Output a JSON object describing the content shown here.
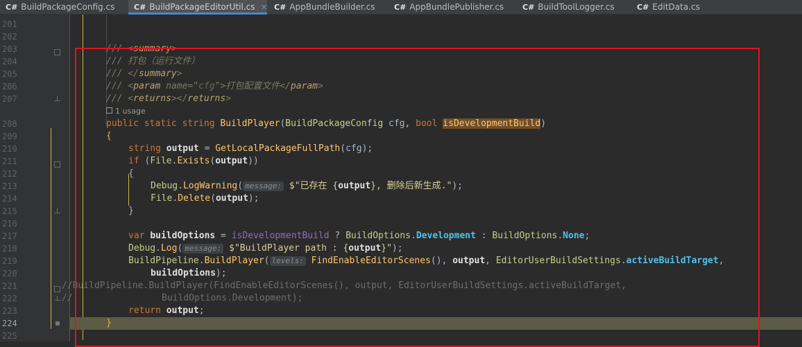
{
  "tabs": [
    {
      "icon": "C#",
      "label": "BuildPackageConfig.cs",
      "active": false
    },
    {
      "icon": "C#",
      "label": "BuildPackageEditorUtil.cs",
      "active": true,
      "close": "×"
    },
    {
      "icon": "C#",
      "label": "AppBundleBuilder.cs",
      "active": false
    },
    {
      "icon": "C#",
      "label": "AppBundlePublisher.cs",
      "active": false
    },
    {
      "icon": "C#",
      "label": "BuildToolLogger.cs",
      "active": false
    },
    {
      "icon": "C#",
      "label": "EditData.cs",
      "active": false
    }
  ],
  "editor": {
    "line_numbers": [
      "201",
      "202",
      "203",
      "204",
      "205",
      "206",
      "207",
      "208",
      "209",
      "210",
      "211",
      "212",
      "213",
      "214",
      "215",
      "216",
      "217",
      "218",
      "219",
      "220",
      "221",
      "222",
      "223",
      "224",
      "225"
    ],
    "current_line": "224",
    "usage_hint": "1 usage",
    "code": {
      "l203": {
        "a": "/// <",
        "b": "summary",
        "c": ">"
      },
      "l204": {
        "a": "/// 打包（运行文件）"
      },
      "l205": {
        "a": "/// </",
        "b": "summary",
        "c": ">"
      },
      "l206": {
        "a": "/// <",
        "b": "param",
        "c": " name=\"",
        "d": "cfg",
        "e": "\">打包配置文件</",
        "f": "param",
        "g": ">"
      },
      "l207": {
        "a": "/// <",
        "b": "returns",
        "c": "></",
        "d": "returns",
        "e": ">"
      },
      "l208": {
        "kw1": "public static string ",
        "mt": "BuildPlayer",
        "p1": "(",
        "ty": "BuildPackageConfig",
        "sp": " cfg, ",
        "kw2": "bool",
        "sp2": " ",
        "hl": "isDevelopmentBuild",
        "p2": ")"
      },
      "l209": {
        "brace": "{"
      },
      "l210": {
        "kw": "string",
        "sp": " ",
        "id": "output",
        "op": " = ",
        "mt": "GetLocalPackageFullPath",
        "rest": "(cfg);"
      },
      "l211": {
        "kw": "if",
        "a": " (",
        "ty": "File",
        "b": ".",
        "mt": "Exists",
        "c": "(",
        "id": "output",
        "d": "))"
      },
      "l212": {
        "a": "{"
      },
      "l213": {
        "ty": "Debug",
        "a": ".",
        "mt": "LogWarning",
        "b": "(",
        "hint": "message:",
        "str1": " $\"已存在 {",
        "sb": "output",
        "str2": "}, 删除后新生成.\"",
        "c": ");"
      },
      "l214": {
        "ty": "File",
        "a": ".",
        "mt": "Delete",
        "b": "(",
        "id": "output",
        "c": ");"
      },
      "l215": {
        "a": "}"
      },
      "l217": {
        "kw": "var",
        "sp": " ",
        "id": "buildOptions",
        "op": " = ",
        "pm": "isDevelopmentBuild",
        "q": " ? ",
        "ty1": "BuildOptions",
        "d1": ".",
        "en1": "Development",
        "c": " : ",
        "ty2": "BuildOptions",
        "d2": ".",
        "en2": "None",
        "e": ";"
      },
      "l218": {
        "ty": "Debug",
        "a": ".",
        "mt": "Log",
        "b": "(",
        "hint": "message:",
        "str1": " $\"BuildPlayer path : {",
        "sb": "output",
        "str2": "}\"",
        "c": ");"
      },
      "l219": {
        "ty": "BuildPipeline",
        "a": ".",
        "mt": "BuildPlayer",
        "b": "(",
        "hint": "levels:",
        "mt2": " FindEnableEditorScenes",
        "c": "(), ",
        "id": "output",
        "d": ", ",
        "ty2": "EditorUserBuildSettings",
        "e": ".",
        "en": "activeBuildTarget",
        "f": ","
      },
      "l220": {
        "id": "buildOptions",
        "a": ");"
      },
      "l221": {
        "a": "//BuildPipeline.BuildPlayer(FindEnableEditorScenes(), output, EditorUserBuildSettings.activeBuildTarget,"
      },
      "l222": {
        "a": "//",
        "b": "BuildOptions.Development);"
      },
      "l223": {
        "kw": "return",
        "sp": " ",
        "id": "output",
        "a": ";"
      },
      "l224": {
        "brace": "}"
      }
    }
  },
  "colors": {
    "annotation_box": "#e0141e",
    "indent_guide": "#d4b43b"
  }
}
